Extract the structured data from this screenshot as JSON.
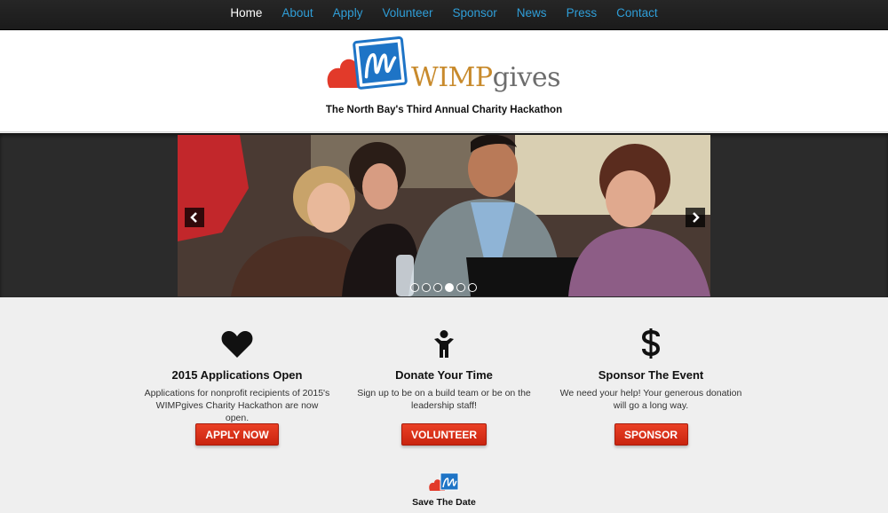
{
  "nav": {
    "items": [
      {
        "label": "Home",
        "active": true
      },
      {
        "label": "About"
      },
      {
        "label": "Apply"
      },
      {
        "label": "Volunteer"
      },
      {
        "label": "Sponsor"
      },
      {
        "label": "News"
      },
      {
        "label": "Press"
      },
      {
        "label": "Contact"
      }
    ]
  },
  "brand": {
    "wordmark_a": "WIMP",
    "wordmark_b": "gives",
    "tagline": "The North Bay's Third Annual Charity Hackathon"
  },
  "carousel": {
    "prev_icon": "chevron-left-icon",
    "next_icon": "chevron-right-icon",
    "slide_count": 6,
    "active_slide": 4
  },
  "features": [
    {
      "icon": "heart-icon",
      "title": "2015 Applications Open",
      "desc": "Applications for nonprofit recipients of 2015's WIMPgives Charity Hackathon are now open.",
      "button": "APPLY NOW"
    },
    {
      "icon": "child-icon",
      "title": "Donate Your Time",
      "desc": "Sign up to be on a build team or be on the leadership staff!",
      "button": "VOLUNTEER"
    },
    {
      "icon": "dollar-icon",
      "title": "Sponsor The Event",
      "desc": "We need your help! Your generous donation will go a long way.",
      "button": "SPONSOR"
    }
  ],
  "footer": {
    "save_the_date": "Save The Date"
  },
  "colors": {
    "nav_bg": "#1f1f1f",
    "nav_link": "#2f9ed8",
    "brand_red": "#e23a2a",
    "brand_blue": "#1e74c6",
    "brand_gold": "#c88a2c",
    "button_red": "#d8321a",
    "page_bg": "#efefef"
  }
}
